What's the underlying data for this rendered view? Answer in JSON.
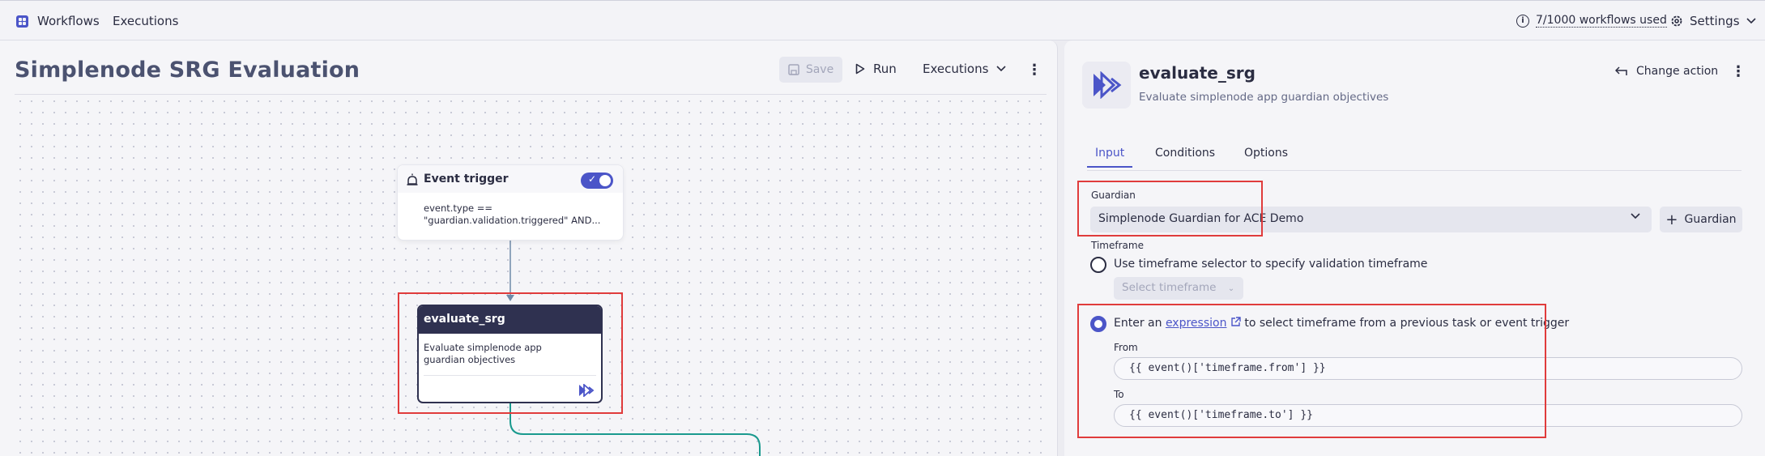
{
  "topbar": {
    "workflows_label": "Workflows",
    "executions_label": "Executions",
    "usage": "7/1000 workflows used",
    "settings_label": "Settings"
  },
  "editor": {
    "title": "Simplenode SRG Evaluation",
    "save_label": "Save",
    "run_label": "Run",
    "executions_label": "Executions"
  },
  "canvas": {
    "trigger_node": {
      "name": "Event trigger",
      "condition_line1": "event.type ==",
      "condition_line2": "\"guardian.validation.triggered\" AND..."
    },
    "task_node": {
      "name": "evaluate_srg",
      "description": "Evaluate simplenode app guardian objectives"
    }
  },
  "details": {
    "action_name": "evaluate_srg",
    "action_description": "Evaluate simplenode app guardian objectives",
    "change_action_label": "Change action",
    "tabs": [
      "Input",
      "Conditions",
      "Options"
    ],
    "active_tab": "Input",
    "guardian_label": "Guardian",
    "guardian_value": "Simplenode Guardian for ACE Demo",
    "add_guardian_label": "Guardian",
    "timeframe_label": "Timeframe",
    "option_selector_label": "Use timeframe selector to specify validation timeframe",
    "select_timeframe_label": "Select timeframe",
    "option_expression_prefix": "Enter an",
    "option_expression_link": "expression",
    "option_expression_suffix": "to select timeframe from a previous task or event trigger",
    "from_label": "From",
    "from_value": "{{ event()['timeframe.from'] }}",
    "to_label": "To",
    "to_value": "{{ event()['timeframe.to'] }}"
  },
  "colors": {
    "accent": "#4b55c8",
    "highlight": "#e03c3c",
    "connector_teal": "#1a9a8e"
  }
}
